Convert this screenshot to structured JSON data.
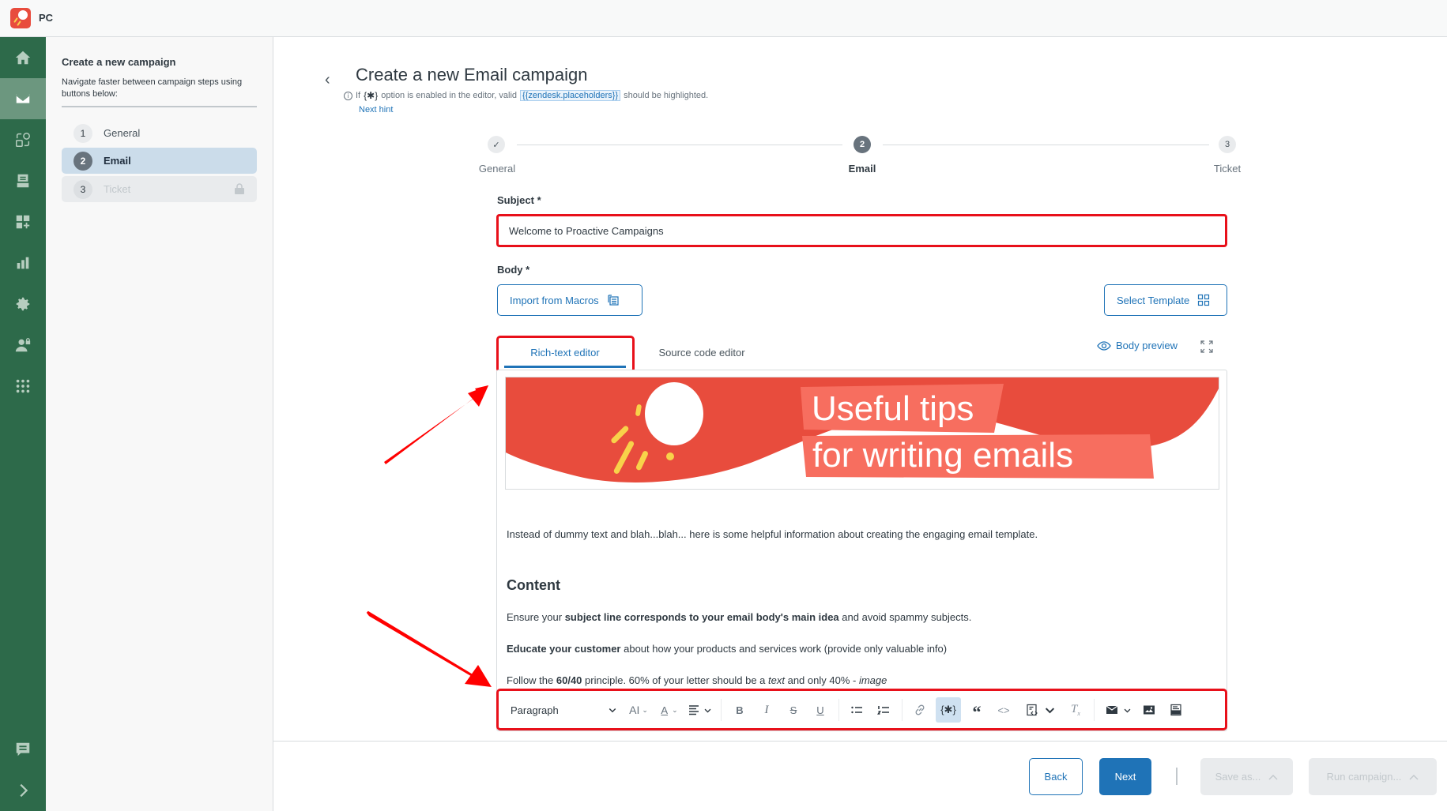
{
  "app": {
    "name": "PC"
  },
  "rail": {
    "items": [
      {
        "icon": "home-icon",
        "active": false
      },
      {
        "icon": "mail-icon",
        "active": true
      },
      {
        "icon": "automation-icon",
        "active": false
      },
      {
        "icon": "archive-icon",
        "active": false
      },
      {
        "icon": "add-widget-icon",
        "active": false
      },
      {
        "icon": "reports-icon",
        "active": false
      },
      {
        "icon": "settings-icon",
        "active": false
      },
      {
        "icon": "user-lock-icon",
        "active": false
      },
      {
        "icon": "apps-grid-icon",
        "active": false
      }
    ],
    "bottom": [
      {
        "icon": "chat-icon"
      },
      {
        "icon": "expand-chevron-icon"
      }
    ]
  },
  "sidebar": {
    "title": "Create a new campaign",
    "description": "Navigate faster between campaign steps using buttons below:",
    "steps": [
      {
        "num": "1",
        "label": "General",
        "state": "done"
      },
      {
        "num": "2",
        "label": "Email",
        "state": "active"
      },
      {
        "num": "3",
        "label": "Ticket",
        "state": "locked"
      }
    ]
  },
  "header": {
    "title": "Create a new Email campaign",
    "hint_prefix": "If",
    "hint_token": "{✱}",
    "hint_middle": "option is enabled in the editor, valid",
    "hint_placeholder": "{{zendesk.placeholders}}",
    "hint_suffix": "should be highlighted.",
    "next_hint": "Next hint"
  },
  "stepper": {
    "steps": [
      {
        "label": "General",
        "marker": "✓",
        "state": "done"
      },
      {
        "label": "Email",
        "marker": "2",
        "state": "current"
      },
      {
        "label": "Ticket",
        "marker": "3",
        "state": "upcoming"
      }
    ]
  },
  "form": {
    "subject_label": "Subject *",
    "subject_value": "Welcome to Proactive Campaigns",
    "body_label": "Body *",
    "import_macros": "Import from Macros",
    "select_template": "Select Template",
    "tabs": [
      {
        "label": "Rich-text editor",
        "active": true
      },
      {
        "label": "Source code editor",
        "active": false
      }
    ],
    "body_preview": "Body preview"
  },
  "editor": {
    "banner": {
      "line1": "Useful tips",
      "line2": "for writing emails"
    },
    "intro": "Instead of dummy text and blah...blah... here is some helpful information about creating the engaging email template.",
    "heading": "Content",
    "p1": {
      "a": "Ensure your ",
      "b": "subject line corresponds to your email body's main idea",
      "c": " and avoid spammy subjects."
    },
    "p2": {
      "a": "Educate your customer",
      "b": " about how your products and services work (provide only valuable info)"
    },
    "p3": {
      "a": "Follow the ",
      "b": "60/40",
      "c": " principle. 60% of your letter should be a ",
      "d": "text",
      "e": " and only 40% - ",
      "f": "image"
    }
  },
  "toolbar": {
    "block_format": "Paragraph",
    "buttons": [
      "font-size",
      "font-color",
      "align",
      "bold",
      "italic",
      "strikethrough",
      "underline",
      "bullet-list",
      "numbered-list",
      "link",
      "placeholder-highlight",
      "blockquote",
      "code",
      "source-snippet",
      "clear-format",
      "email-insert",
      "image",
      "html-block"
    ]
  },
  "footer": {
    "back": "Back",
    "next": "Next",
    "save_as": "Save as...",
    "run_campaign": "Run campaign..."
  },
  "colors": {
    "rail": "#2d6a4a",
    "primary": "#1f73b7",
    "annotation": "#e8101a",
    "banner_red": "#e84c3d",
    "banner_yellow": "#f8d24a"
  }
}
